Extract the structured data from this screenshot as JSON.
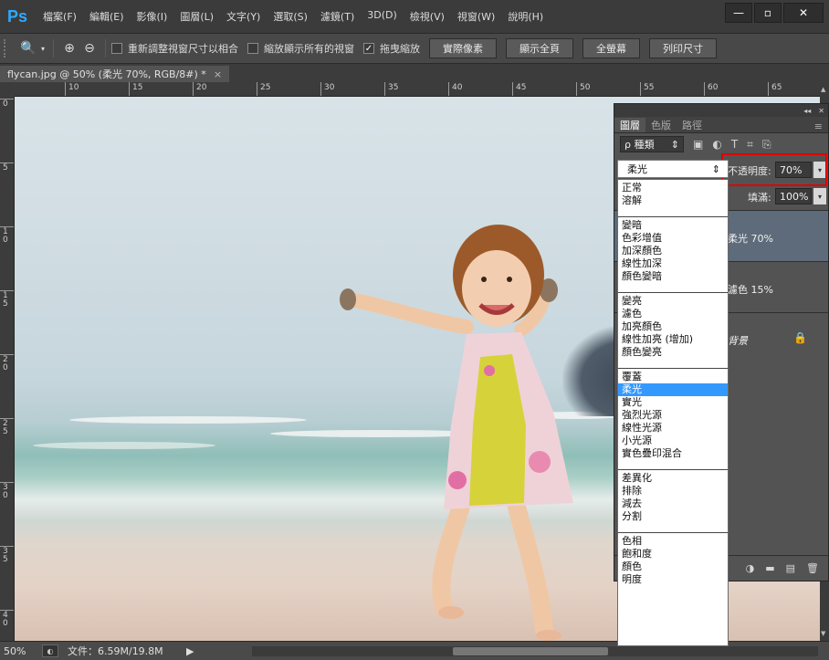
{
  "app": {
    "logo": "Ps"
  },
  "menu": [
    "檔案(F)",
    "編輯(E)",
    "影像(I)",
    "圖層(L)",
    "文字(Y)",
    "選取(S)",
    "濾鏡(T)",
    "3D(D)",
    "檢視(V)",
    "視窗(W)",
    "說明(H)"
  ],
  "window_controls": {
    "minimize": "—",
    "maximize": "▫",
    "close": "✕"
  },
  "options": {
    "checkbox_resize": {
      "label": "重新調整視窗尺寸以相合",
      "checked": false
    },
    "checkbox_zoom_all": {
      "label": "縮放顯示所有的視窗",
      "checked": false
    },
    "checkbox_scrubby": {
      "label": "拖曳縮放",
      "checked": true
    },
    "buttons": [
      "實際像素",
      "顯示全頁",
      "全螢幕",
      "列印尺寸"
    ]
  },
  "document": {
    "tab_title": "flycan.jpg @ 50% (柔光 70%, RGB/8#) *",
    "close": "×"
  },
  "ruler": {
    "h": [
      "10",
      "15",
      "20",
      "25",
      "30",
      "35",
      "40",
      "45",
      "50",
      "55",
      "60",
      "65"
    ],
    "v": [
      "0",
      "5",
      "10",
      "15",
      "20",
      "25",
      "30",
      "35",
      "40"
    ]
  },
  "status": {
    "zoom": "50%",
    "file_info": "文件：6.59M/19.8M",
    "arrow": "▶"
  },
  "layers_panel": {
    "tabs": [
      "圖層",
      "色版",
      "路徑"
    ],
    "active_tab": 0,
    "filter_label": "ρ 種類",
    "opacity_label": "不透明度:",
    "opacity_value": "70%",
    "fill_label": "填滿:",
    "fill_value": "100%",
    "layers": [
      {
        "name": "柔光 70%",
        "selected": true
      },
      {
        "name": "濾色 15%",
        "selected": false
      },
      {
        "name": "背景",
        "selected": false,
        "locked": true
      }
    ]
  },
  "blend_mode": {
    "current": "柔光",
    "groups": [
      [
        "正常",
        "溶解"
      ],
      [
        "變暗",
        "色彩增值",
        "加深顏色",
        "線性加深",
        "顏色變暗"
      ],
      [
        "變亮",
        "濾色",
        "加亮顏色",
        "線性加亮 (增加)",
        "顏色變亮"
      ],
      [
        "覆蓋",
        "柔光",
        "實光",
        "強烈光源",
        "線性光源",
        "小光源",
        "實色疊印混合"
      ],
      [
        "差異化",
        "排除",
        "減去",
        "分割"
      ],
      [
        "色相",
        "飽和度",
        "顏色",
        "明度"
      ]
    ],
    "selected_item": "柔光"
  },
  "colors": {
    "accent_selection": "#3399ff",
    "highlight_box": "#e00000",
    "ps_logo": "#31a8ff"
  }
}
